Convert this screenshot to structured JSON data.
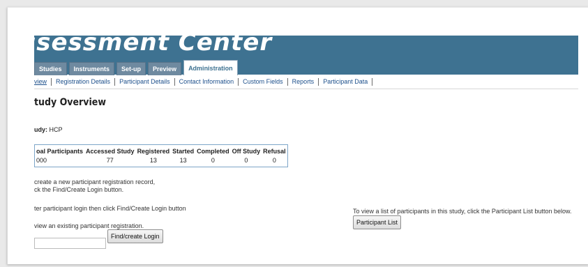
{
  "app": {
    "banner_title": "ssessment Center"
  },
  "top_tabs": [
    {
      "label": "Studies",
      "active": false
    },
    {
      "label": "Instruments",
      "active": false
    },
    {
      "label": "Set-up",
      "active": false
    },
    {
      "label": "Preview",
      "active": false
    },
    {
      "label": "Administration",
      "active": true
    }
  ],
  "sub_tabs": [
    {
      "label": "view"
    },
    {
      "label": "Registration Details"
    },
    {
      "label": "Participant Details"
    },
    {
      "label": "Contact Information"
    },
    {
      "label": "Custom Fields"
    },
    {
      "label": "Reports"
    },
    {
      "label": "Participant Data"
    }
  ],
  "page": {
    "title": "tudy Overview",
    "study_label": "udy:",
    "study_value": "HCP"
  },
  "overview": {
    "headers": [
      "oal Participants",
      "Accessed Study",
      "Registered",
      "Started",
      "Completed",
      "Off Study",
      "Refusal"
    ],
    "values": [
      "000",
      "77",
      "13",
      "13",
      "0",
      "0",
      "0"
    ]
  },
  "instructions": {
    "create_line1": "create a new participant registration record,",
    "create_line2": "ck the Find/Create Login button.",
    "enter_login": "ter participant login then click Find/Create Login button",
    "view_existing": "view an existing participant registration.",
    "participant_list_hint": "To view a list of participants in this study, click the Participant List button below."
  },
  "login": {
    "value": "",
    "button": "Find/create Login"
  },
  "participant_list": {
    "button": "Participant List"
  },
  "colors": {
    "banner": "#3e7291",
    "link": "#1c4f8b",
    "table_border": "#7da5c8"
  }
}
